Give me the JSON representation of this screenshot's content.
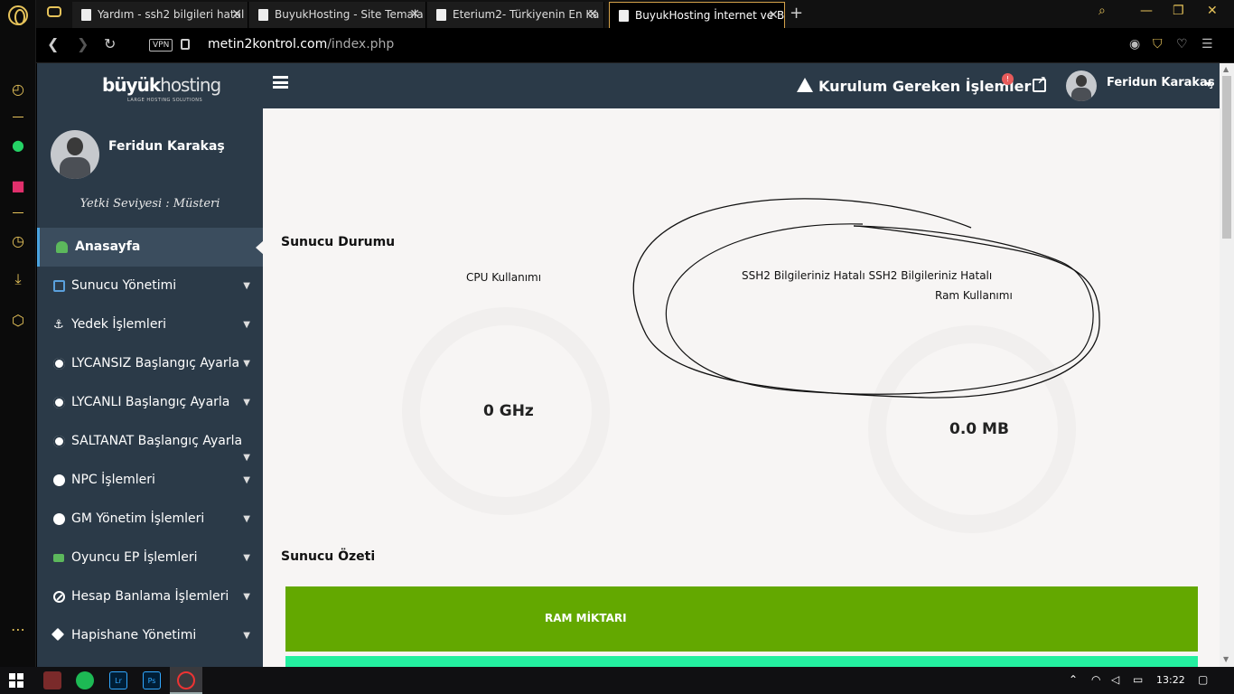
{
  "browser": {
    "tabs": [
      {
        "title": "Yardım - ssh2 bilgileri hatal",
        "active": false
      },
      {
        "title": "BuyukHosting - Site Temala",
        "active": false
      },
      {
        "title": "Eterium2- Türkiyenin En Ka",
        "active": false
      },
      {
        "title": "BuyukHosting İnternet ve B",
        "active": true
      }
    ],
    "vpn_label": "VPN",
    "url_host": "metin2kontrol.com",
    "url_path": "/index.php",
    "new_tab_glyph": "+",
    "close_glyph": "✕"
  },
  "brand": {
    "logo_bold": "büyük",
    "logo_light": "hosting",
    "tagline": "LARGE HOSTING SOLUTIONS"
  },
  "profile": {
    "name": "Feridun Karakaş",
    "role": "Yetki Seviyesi : Müsteri"
  },
  "sidebar": {
    "items": [
      {
        "label": "Anasayfa",
        "icon": "dashboard-icon",
        "active": true,
        "has_children": false
      },
      {
        "label": "Sunucu Yönetimi",
        "icon": "server-icon",
        "active": false,
        "has_children": true
      },
      {
        "label": "Yedek İşlemleri",
        "icon": "anchor-icon",
        "active": false,
        "has_children": true
      },
      {
        "label": "LYCANSIZ Başlangıç Ayarla",
        "icon": "gear-icon",
        "active": false,
        "has_children": true
      },
      {
        "label": "LYCANLI Başlangıç Ayarla",
        "icon": "gear-icon",
        "active": false,
        "has_children": true
      },
      {
        "label": "SALTANAT Başlangıç Ayarla",
        "icon": "gear-icon",
        "active": false,
        "has_children": true
      },
      {
        "label": "NPC İşlemleri",
        "icon": "plus-circle-icon",
        "active": false,
        "has_children": true
      },
      {
        "label": "GM Yönetim İşlemleri",
        "icon": "user-icon",
        "active": false,
        "has_children": true
      },
      {
        "label": "Oyuncu EP İşlemleri",
        "icon": "cart-icon",
        "active": false,
        "has_children": true
      },
      {
        "label": "Hesap Banlama İşlemleri",
        "icon": "ban-icon",
        "active": false,
        "has_children": true
      },
      {
        "label": "Hapishane Yönetimi",
        "icon": "gavel-icon",
        "active": false,
        "has_children": true
      }
    ]
  },
  "topbar": {
    "warning_label": "Kurulum Gereken İşlemler",
    "notification_count": "!",
    "user_name": "Feridun Karakaş"
  },
  "main": {
    "status_title": "Sunucu Durumu",
    "cpu_label": "CPU Kullanımı",
    "cpu_value": "0 GHz",
    "ssh_error": "SSH2 Bilgileriniz Hatalı SSH2 Bilgileriniz Hatalı",
    "ram_label": "Ram Kullanımı",
    "ram_value": "0.0 MB",
    "summary_title": "Sunucu Özeti",
    "summary_bar_label": "RAM MİKTARI"
  },
  "taskbar": {
    "time": "13:22",
    "apps": [
      "opera-gx-icon",
      "spotify-icon",
      "lightroom-icon",
      "photoshop-icon",
      "opera-icon"
    ],
    "app_labels": {
      "lightroom": "Lr",
      "photoshop": "Ps"
    }
  },
  "colors": {
    "sidebar_bg": "#2b3a48",
    "page_bg": "#f7f5f4",
    "summary_green": "#63a800",
    "summary_mint": "#24f0a0",
    "browser_accent": "#e6c35a"
  }
}
